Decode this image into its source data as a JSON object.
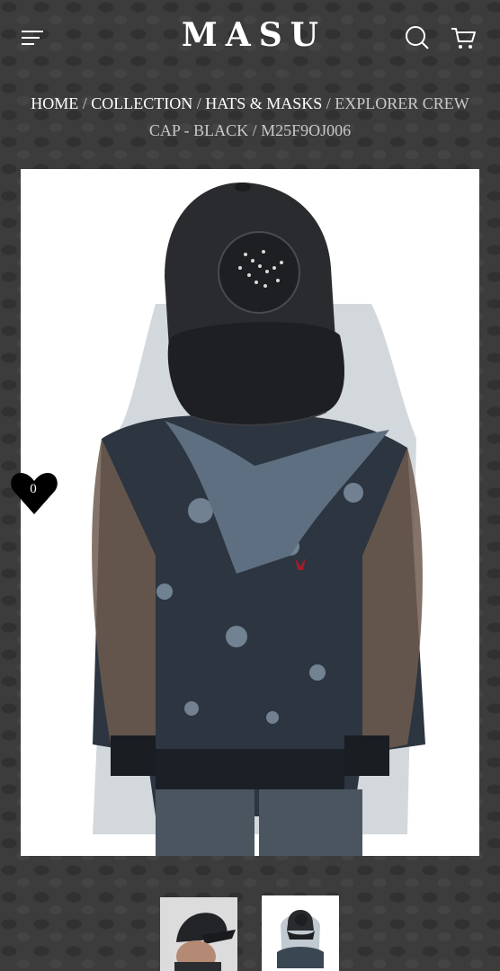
{
  "header": {
    "logo": "MASU",
    "menu_icon": "hamburger-menu-icon",
    "search_icon": "search-icon",
    "cart_icon": "cart-icon"
  },
  "breadcrumb": {
    "items": [
      "HOME",
      "COLLECTION",
      "HATS & MASKS"
    ],
    "separator": "/",
    "current": "EXPLORER CREW CAP - BLACK / M25F9OJ006"
  },
  "wishlist": {
    "icon": "heart-icon",
    "count": "0"
  },
  "thumbnails": [
    {
      "name": "thumbnail-model-cap"
    },
    {
      "name": "thumbnail-cap-with-veil",
      "selected": true
    }
  ],
  "colors": {
    "background": "#3c3c3c",
    "text": "#ffffff",
    "muted": "#c9c9c9"
  }
}
